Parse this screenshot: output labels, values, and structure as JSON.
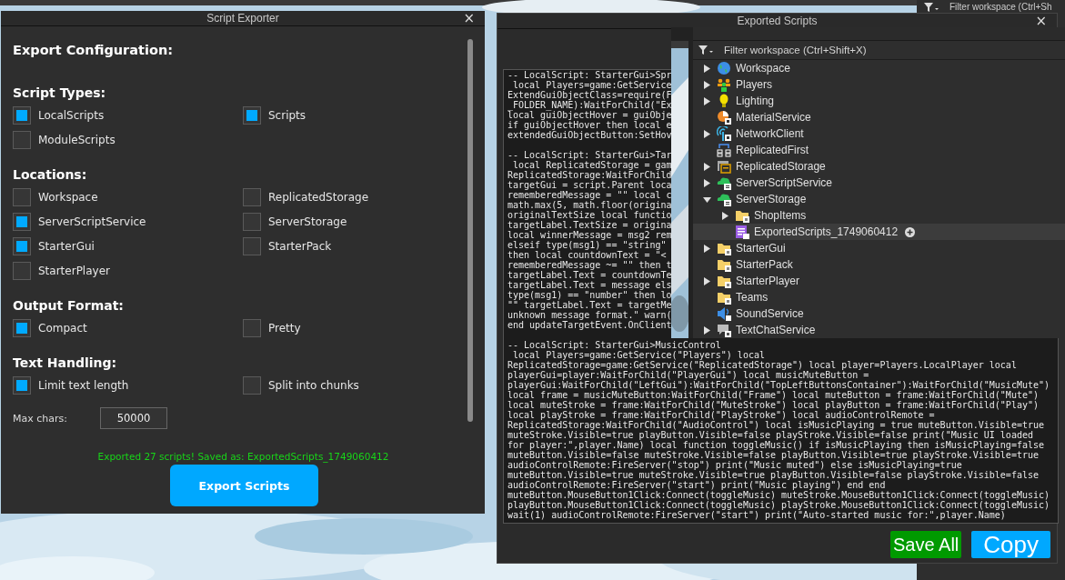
{
  "background_panel": {
    "filter_text": "Filter workspace (Ctrl+Sh"
  },
  "script_exporter": {
    "title": "Script Exporter",
    "close": "×",
    "heading": "Export Configuration:",
    "sections": [
      {
        "title": "Script Types:",
        "options": [
          {
            "label": "LocalScripts",
            "checked": true
          },
          {
            "label": "Scripts",
            "checked": true
          },
          {
            "label": "ModuleScripts",
            "checked": false
          }
        ]
      },
      {
        "title": "Locations:",
        "options": [
          {
            "label": "Workspace",
            "checked": false
          },
          {
            "label": "ReplicatedStorage",
            "checked": false
          },
          {
            "label": "ServerScriptService",
            "checked": true
          },
          {
            "label": "ServerStorage",
            "checked": false
          },
          {
            "label": "StarterGui",
            "checked": true
          },
          {
            "label": "StarterPack",
            "checked": false
          },
          {
            "label": "StarterPlayer",
            "checked": false
          }
        ]
      },
      {
        "title": "Output Format:",
        "options": [
          {
            "label": "Compact",
            "checked": true
          },
          {
            "label": "Pretty",
            "checked": false
          }
        ]
      },
      {
        "title": "Text Handling:",
        "options": [
          {
            "label": "Limit text length",
            "checked": true
          },
          {
            "label": "Split into chunks",
            "checked": false
          }
        ]
      }
    ],
    "max_chars": {
      "label": "Max chars:",
      "value": "50000"
    },
    "status": "Exported 27 scripts! Saved as: ExportedScripts_1749060412",
    "export_button": "Export Scripts"
  },
  "exported_scripts": {
    "title": "Exported Scripts",
    "close": "×",
    "code_blocks": [
      [
        "-- LocalScript: StarterGui>Spr",
        " local Players=game:GetService",
        "ExtendGuiObjectClass=require(F",
        "_FOLDER_NAME):WaitForChild(\"Ex",
        "local guiObjectHover = guiObje",
        "if guiObjectHover then local e",
        "extendedGuiObjectButton:SetHov"
      ],
      [
        "-- LocalScript: StarterGui>Tar",
        " local ReplicatedStorage = gam",
        "ReplicatedStorage:WaitForChild",
        "targetGui = script.Parent loca",
        "rememberedMessage = \"\" local c",
        "math.max(5, math.floor(origina",
        "originalTextSize local functio",
        "targetLabel.TextSize = origina",
        "local winnerMessage = msg2 rem",
        "elseif type(msg1) == \"string\"",
        "then local countdownText = \"<",
        "rememberedMessage ~= \"\" then t",
        "targetLabel.Text = countdownTe",
        "targetLabel.Text = message els",
        "type(msg1) == \"number\" then lo",
        "\"\" targetLabel.Text = targetMe",
        "unknown message format.\" warn(",
        "end updateTargetEvent.OnClient"
      ],
      [
        "-- LocalScript: StarterGui>MusicControl",
        " local Players=game:GetService(\"Players\") local",
        "ReplicatedStorage=game:GetService(\"ReplicatedStorage\") local player=Players.LocalPlayer local",
        "playerGui=player:WaitForChild(\"PlayerGui\") local musicMuteButton =",
        "playerGui:WaitForChild(\"LeftGui\"):WaitForChild(\"TopLeftButtonsContainer\"):WaitForChild(\"MusicMute\")",
        "local frame = musicMuteButton:WaitForChild(\"Frame\") local muteButton = frame:WaitForChild(\"Mute\")",
        "local muteStroke = frame:WaitForChild(\"MuteStroke\") local playButton = frame:WaitForChild(\"Play\")",
        "local playStroke = frame:WaitForChild(\"PlayStroke\") local audioControlRemote =",
        "ReplicatedStorage:WaitForChild(\"AudioControl\") local isMusicPlaying = true muteButton.Visible=true",
        "muteStroke.Visible=true playButton.Visible=false playStroke.Visible=false print(\"Music UI loaded",
        "for player:\",player.Name) local function toggleMusic() if isMusicPlaying then isMusicPlaying=false",
        "muteButton.Visible=false muteStroke.Visible=false playButton.Visible=true playStroke.Visible=true",
        "audioControlRemote:FireServer(\"stop\") print(\"Music muted\") else isMusicPlaying=true",
        "muteButton.Visible=true muteStroke.Visible=true playButton.Visible=false playStroke.Visible=false",
        "audioControlRemote:FireServer(\"start\") print(\"Music playing\") end end",
        "muteButton.MouseButton1Click:Connect(toggleMusic) muteStroke.MouseButton1Click:Connect(toggleMusic)",
        "playButton.MouseButton1Click:Connect(toggleMusic) playStroke.MouseButton1Click:Connect(toggleMusic)",
        "wait(1) audioControlRemote:FireServer(\"start\") print(\"Auto-started music for:\",player.Name)"
      ]
    ],
    "buttons": [
      {
        "label": "Save All",
        "kind": "save"
      },
      {
        "label": "Copy",
        "kind": "copy"
      }
    ]
  },
  "explorer": {
    "placeholder": "Filter workspace (Ctrl+Shift+X)",
    "items": [
      {
        "label": "Workspace",
        "kind": "globe",
        "expanded": false,
        "selected": false
      },
      {
        "label": "Players",
        "kind": "people",
        "expanded": false,
        "selected": false
      },
      {
        "label": "Lighting",
        "kind": "bulb",
        "expanded": false,
        "selected": false
      },
      {
        "label": "MaterialService",
        "kind": "material",
        "selected": false
      },
      {
        "label": "NetworkClient",
        "kind": "antenna",
        "expanded": false,
        "selected": false
      },
      {
        "label": "ReplicatedFirst",
        "kind": "hierarchy",
        "selected": false
      },
      {
        "label": "ReplicatedStorage",
        "kind": "storage",
        "expanded": false,
        "selected": false
      },
      {
        "label": "ServerScriptService",
        "kind": "cloud",
        "expanded": false,
        "selected": false
      },
      {
        "label": "ServerStorage",
        "kind": "cloud",
        "expanded": true,
        "selected": false,
        "children": [
          {
            "label": "ShopItems",
            "kind": "folder",
            "expanded": false,
            "selected": false
          },
          {
            "label": "ExportedScripts_1749060412",
            "kind": "script",
            "selected": true
          }
        ]
      },
      {
        "label": "StarterGui",
        "kind": "folder",
        "expanded": false,
        "selected": false
      },
      {
        "label": "StarterPack",
        "kind": "folder",
        "selected": false
      },
      {
        "label": "StarterPlayer",
        "kind": "folder",
        "expanded": false,
        "selected": false
      },
      {
        "label": "Teams",
        "kind": "folder",
        "selected": false
      },
      {
        "label": "SoundService",
        "kind": "speaker",
        "selected": false
      },
      {
        "label": "TextChatService",
        "kind": "chat",
        "expanded": false,
        "selected": false
      }
    ]
  }
}
